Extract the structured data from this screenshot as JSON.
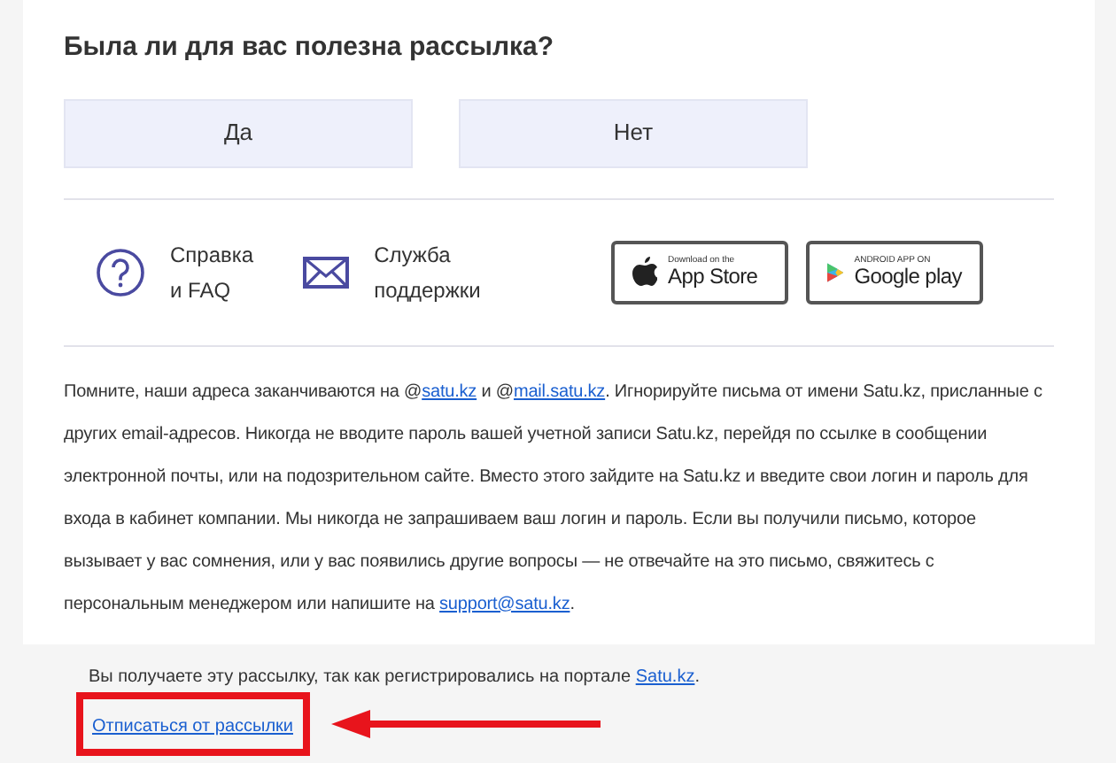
{
  "survey": {
    "title": "Была ли для вас полезна рассылка?",
    "answers": [
      "Да",
      "Нет"
    ]
  },
  "help_links": [
    {
      "kind": "help",
      "lines": [
        "Справка",
        "и FAQ"
      ]
    },
    {
      "kind": "support",
      "lines": [
        "Служба",
        "поддержки"
      ]
    }
  ],
  "store_badges": [
    {
      "kind": "apple",
      "small": "Download on the",
      "big": "App Store"
    },
    {
      "kind": "google",
      "small": "ANDROID APP ON",
      "big": "Google play"
    }
  ],
  "notice": [
    {
      "kind": "text",
      "text": "Помните, наши адреса заканчиваются на @"
    },
    {
      "kind": "link",
      "text": "satu.kz"
    },
    {
      "kind": "text",
      "text": " и @"
    },
    {
      "kind": "link",
      "text": "mail.satu.kz"
    },
    {
      "kind": "text",
      "text": ". Игнорируйте письма от имени Satu.kz, присланные с других email-адресов. Никогда не вводите пароль вашей учетной записи Satu.kz, перейдя по ссылке в сообщении электронной почты, или на подозрительном сайте. Вместо этого зайдите на Satu.kz и введите свои логин и пароль для входа в кабинет компании. Мы никогда не запрашиваем ваш логин и пароль. Если вы получили письмо, которое вызывает у вас сомнения, или у вас появились другие вопросы — не отвечайте на это письмо, свяжитесь с персональным менеджером или напишите на "
    },
    {
      "kind": "link",
      "text": "support@satu.kz"
    },
    {
      "kind": "text",
      "text": "."
    }
  ],
  "footer": [
    {
      "kind": "text",
      "text": "Вы получаете эту рассылку, так как регистрировались на портале "
    },
    {
      "kind": "link",
      "text": "Satu.kz"
    },
    {
      "kind": "text",
      "text": "."
    }
  ],
  "unsubscribe": {
    "text": "Отписаться от рассылки",
    "highlighted": true
  }
}
